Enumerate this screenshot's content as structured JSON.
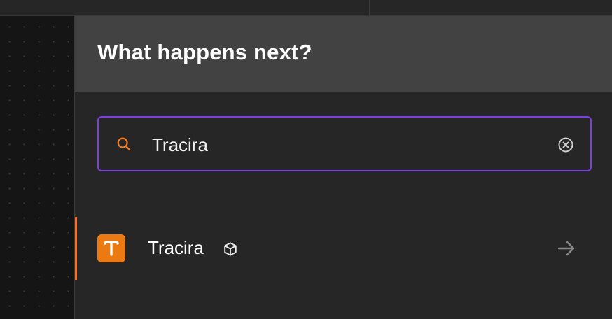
{
  "panel": {
    "title": "What happens next?"
  },
  "search": {
    "value": "Tracira"
  },
  "results": [
    {
      "label": "Tracira",
      "logo_letter": "T",
      "logo_color": "#ec7a12",
      "icons": [
        "cube-icon",
        "arrow-right-icon"
      ]
    }
  ],
  "colors": {
    "accent_border": "#7b3fe4",
    "selection_indicator": "#ff6d1b",
    "search_icon": "#f57c1f"
  }
}
